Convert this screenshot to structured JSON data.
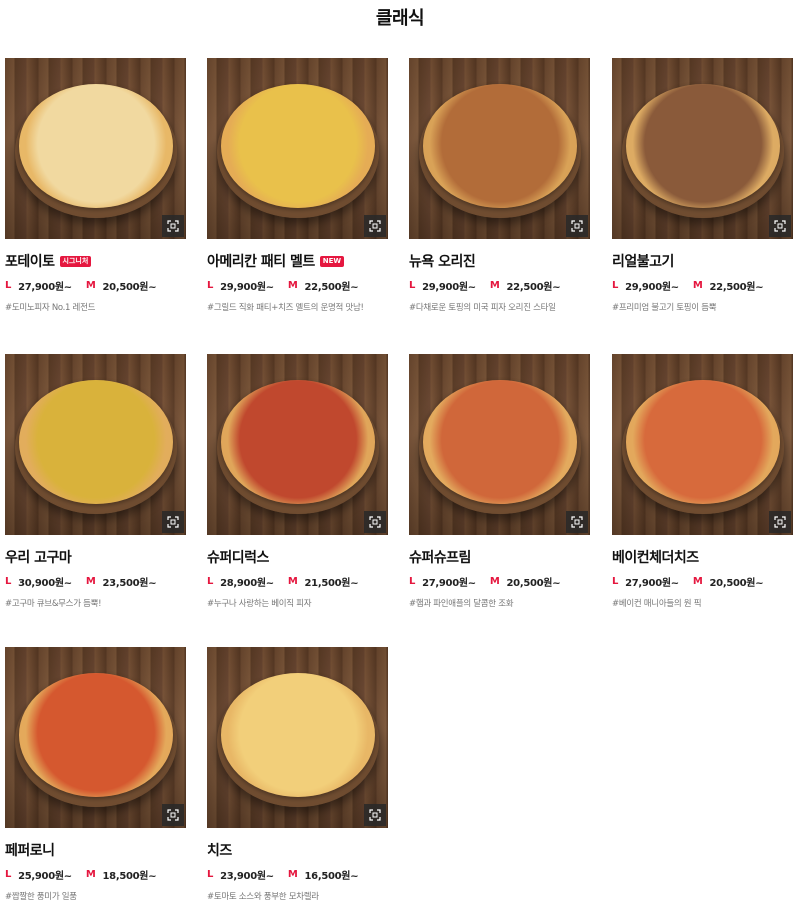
{
  "section": {
    "title": "클래식"
  },
  "labels": {
    "large": "L",
    "medium": "M"
  },
  "pizzas": [
    {
      "name": "포테이토",
      "badge": "시그니처",
      "large_price": "27,900원~",
      "medium_price": "20,500원~",
      "desc": "#도미노피자 No.1 레전드",
      "crust": "#e8b867",
      "topping": "#f1d9a0"
    },
    {
      "name": "아메리칸 패티 멜트",
      "badge": "NEW",
      "large_price": "29,900원~",
      "medium_price": "22,500원~",
      "desc": "#그릴드 직화 패티+치즈 멜트의 운명적 맛남!",
      "crust": "#e5ac55",
      "topping": "#e9c14b"
    },
    {
      "name": "뉴욕 오리진",
      "badge": "",
      "large_price": "29,900원~",
      "medium_price": "22,500원~",
      "desc": "#다채로운 토핑의 미국 피자 오리진 스타일",
      "crust": "#d9a257",
      "topping": "#b26c39"
    },
    {
      "name": "리얼불고기",
      "badge": "",
      "large_price": "29,900원~",
      "medium_price": "22,500원~",
      "desc": "#프리미엄 불고기 토핑이 듬뿍",
      "crust": "#ddab63",
      "topping": "#8a5a3a"
    },
    {
      "name": "우리 고구마",
      "badge": "",
      "large_price": "30,900원~",
      "medium_price": "23,500원~",
      "desc": "#고구마 큐브&무스가 듬뿍!",
      "crust": "#e2ad5c",
      "topping": "#d9b23b"
    },
    {
      "name": "슈퍼디럭스",
      "badge": "",
      "large_price": "28,900원~",
      "medium_price": "21,500원~",
      "desc": "#누구나 사랑하는 베이직 피자",
      "crust": "#e0a65a",
      "topping": "#c0482e"
    },
    {
      "name": "슈퍼슈프림",
      "badge": "",
      "large_price": "27,900원~",
      "medium_price": "20,500원~",
      "desc": "#햄과 파인애플의 달콤한 조화",
      "crust": "#e3aa5e",
      "topping": "#d0673a"
    },
    {
      "name": "베이컨체더치즈",
      "badge": "",
      "large_price": "27,900원~",
      "medium_price": "20,500원~",
      "desc": "#베이컨 매니아들의 원 픽",
      "crust": "#e3a85c",
      "topping": "#d76a3c"
    },
    {
      "name": "페퍼로니",
      "badge": "",
      "large_price": "25,900원~",
      "medium_price": "18,500원~",
      "desc": "#짭짤한 풍미가 일품",
      "crust": "#e4a95b",
      "topping": "#d5582f"
    },
    {
      "name": "치즈",
      "badge": "",
      "large_price": "23,900원~",
      "medium_price": "16,500원~",
      "desc": "#토마토 소스와 풍부한 모차렐라",
      "crust": "#e8b766",
      "topping": "#f2cf7a"
    }
  ],
  "colors": {
    "accent": "#e5173f",
    "text": "#111111",
    "muted": "#777777"
  },
  "icons": {
    "zoom": "zoom-expand-icon"
  }
}
